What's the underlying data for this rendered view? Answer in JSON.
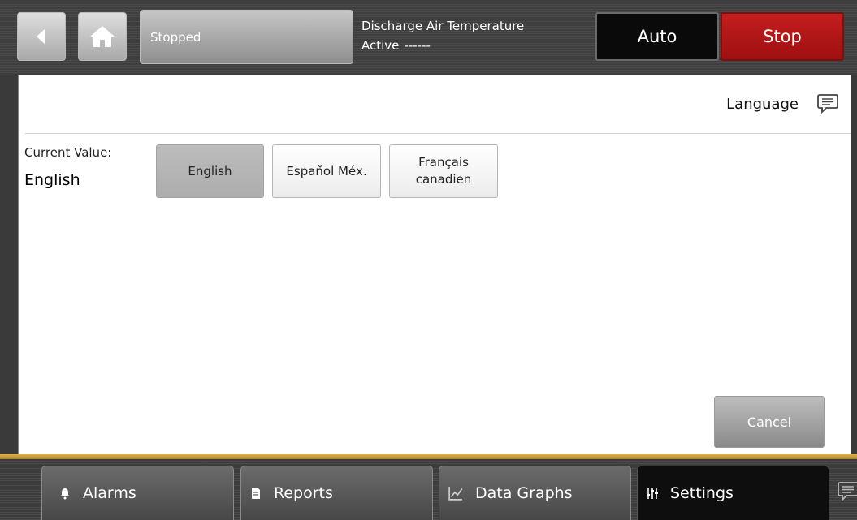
{
  "header": {
    "status": "Stopped",
    "point_name": "Discharge Air Temperature",
    "point_state": "Active",
    "point_value": "------",
    "auto_label": "Auto",
    "stop_label": "Stop",
    "stop_color": "#b81818"
  },
  "panel": {
    "title": "Language",
    "current_value_label": "Current Value:",
    "current_value": "English",
    "options": [
      {
        "label": "English",
        "selected": true
      },
      {
        "label": "Español Méx.",
        "selected": false
      },
      {
        "label_line1": "Français",
        "label_line2": "canadien",
        "selected": false
      }
    ],
    "cancel_label": "Cancel"
  },
  "bottom_nav": {
    "tabs": [
      {
        "label": "Alarms",
        "icon": "bell-icon"
      },
      {
        "label": "Reports",
        "icon": "document-icon"
      },
      {
        "label": "Data Graphs",
        "icon": "chart-icon"
      },
      {
        "label": "Settings",
        "icon": "sliders-icon",
        "active": true
      }
    ],
    "accent_color": "#d4a73e"
  }
}
